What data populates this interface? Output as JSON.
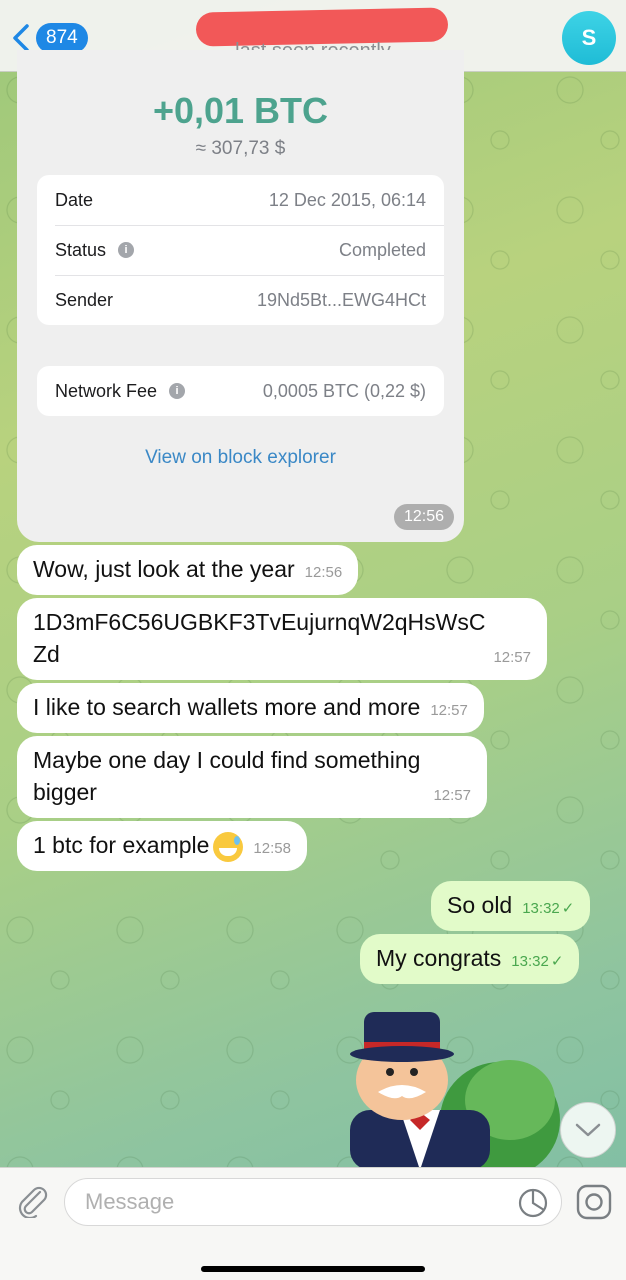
{
  "header": {
    "back_count": "874",
    "status": "last seen recently",
    "avatar_letter": "S"
  },
  "transaction": {
    "amount": "+0,01 BTC",
    "fiat": "≈ 307,73 $",
    "rows": [
      {
        "label": "Date",
        "value": "12 Dec 2015, 06:14"
      },
      {
        "label": "Status",
        "value": "Completed"
      },
      {
        "label": "Sender",
        "value": "19Nd5Bt...EWG4HCt"
      }
    ],
    "fee": {
      "label": "Network Fee",
      "value": "0,0005 BTC (0,22 $)"
    },
    "explorer_link": "View on block explorer",
    "time": "12:56"
  },
  "messages": [
    {
      "text": "Wow, just look at the year",
      "time": "12:56"
    },
    {
      "text": "1D3mF6C56UGBKF3TvEujurnqW2qHsWsCZd",
      "line1": "1D3mF6C56UGBKF3TvEujurnqW2qHsWsC",
      "line2": "Zd",
      "time": "12:57"
    },
    {
      "text": "I like to search wallets more and more",
      "time": "12:57"
    },
    {
      "text": "Maybe one day I could find something bigger",
      "line1": "Maybe one day I could find something",
      "line2": "bigger",
      "time": "12:57"
    },
    {
      "text": "1 btc for example",
      "time": "12:58"
    },
    {
      "text": "So old",
      "time": "13:32"
    },
    {
      "text": "My congrats",
      "time": "13:32"
    }
  ],
  "input": {
    "placeholder": "Message"
  },
  "colors": {
    "accent": "#1e88e5",
    "amount": "#4da38e",
    "outgoing_bubble": "#e2fbc9",
    "redaction": "#f25858"
  }
}
